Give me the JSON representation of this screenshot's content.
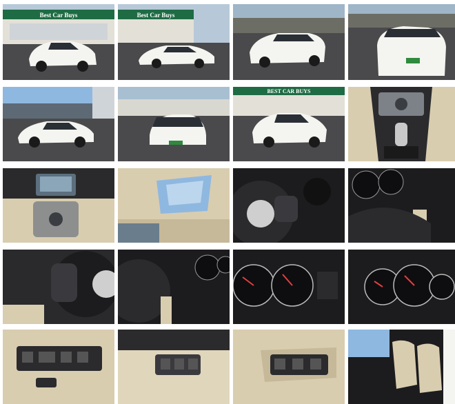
{
  "gallery": {
    "dealer_sign": "Best Car Buys",
    "dealer_sign_upper": "BEST CAR BUYS",
    "photos": [
      {
        "icon": "car-front-three-quarter"
      },
      {
        "icon": "car-side-profile"
      },
      {
        "icon": "car-rear-three-quarter"
      },
      {
        "icon": "car-rear"
      },
      {
        "icon": "car-side-profile"
      },
      {
        "icon": "car-front"
      },
      {
        "icon": "car-front-three-quarter"
      },
      {
        "icon": "center-console-shifter"
      },
      {
        "icon": "dashboard-navigation"
      },
      {
        "icon": "sunroof"
      },
      {
        "icon": "steering-wheel"
      },
      {
        "icon": "instrument-cluster"
      },
      {
        "icon": "steering-wheel"
      },
      {
        "icon": "steering-wheel-cluster"
      },
      {
        "icon": "gauges"
      },
      {
        "icon": "gauges"
      },
      {
        "icon": "door-switches"
      },
      {
        "icon": "window-switches"
      },
      {
        "icon": "door-panel-switches"
      },
      {
        "icon": "front-seats"
      }
    ],
    "colors": {
      "car_white": "#f4f4f0",
      "asphalt": "#4a4a4c",
      "sky": "#8fb8e0",
      "sign_green": "#1e6b44",
      "beige": "#d9cdb0",
      "dark_interior": "#1c1c1e"
    }
  }
}
